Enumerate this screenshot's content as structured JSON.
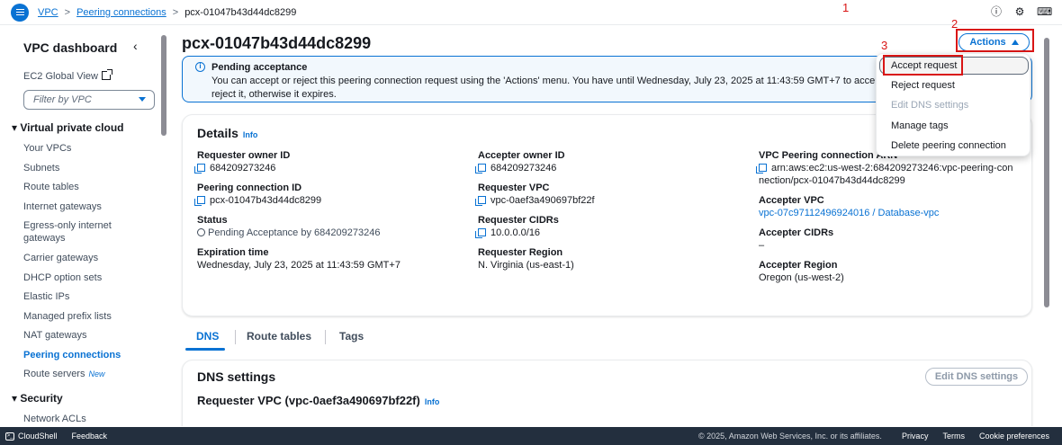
{
  "breadcrumb": {
    "root": "VPC",
    "parent": "Peering connections",
    "current": "pcx-01047b43d44dc8299"
  },
  "annotations": {
    "one": "1",
    "two": "2",
    "three": "3"
  },
  "top_icons": [
    "info-circle-icon",
    "settings-icon",
    "feedback-icon"
  ],
  "sidebar": {
    "title": "VPC dashboard",
    "ec2_global_view": "EC2 Global View",
    "filter_placeholder": "Filter by VPC",
    "section_vpc": "Virtual private cloud",
    "items": [
      "Your VPCs",
      "Subnets",
      "Route tables",
      "Internet gateways",
      "Egress-only internet gateways",
      "Carrier gateways",
      "DHCP option sets",
      "Elastic IPs",
      "Managed prefix lists",
      "NAT gateways",
      "Peering connections",
      "Route servers"
    ],
    "new_badge": "New",
    "section_security": "Security",
    "security_items": [
      "Network ACLs"
    ]
  },
  "page": {
    "title": "pcx-01047b43d44dc8299",
    "actions_label": "Actions"
  },
  "alert": {
    "title": "Pending acceptance",
    "body": "You can accept or reject this peering connection request using the 'Actions' menu. You have until Wednesday, July 23, 2025 at 11:43:59 GMT+7 to accept or reject it, otherwise it expires."
  },
  "details": {
    "title": "Details",
    "info": "Info",
    "requester_owner_id_label": "Requester owner ID",
    "requester_owner_id": "684209273246",
    "peering_id_label": "Peering connection ID",
    "peering_id": "pcx-01047b43d44dc8299",
    "status_label": "Status",
    "status": "Pending Acceptance by 684209273246",
    "expiration_label": "Expiration time",
    "expiration": "Wednesday, July 23, 2025 at 11:43:59 GMT+7",
    "accepter_owner_id_label": "Accepter owner ID",
    "accepter_owner_id": "684209273246",
    "requester_vpc_label": "Requester VPC",
    "requester_vpc": "vpc-0aef3a490697bf22f",
    "requester_cidrs_label": "Requester CIDRs",
    "requester_cidrs": "10.0.0.0/16",
    "requester_region_label": "Requester Region",
    "requester_region": "N. Virginia (us-east-1)",
    "arn_label": "VPC Peering connection ARN",
    "arn_line1": "arn:aws:ec2:us-west-2:684209273246:vpc-peering-con",
    "arn_line2": "nection/pcx-01047b43d44dc8299",
    "accepter_vpc_label": "Accepter VPC",
    "accepter_vpc": "vpc-07c97112496924016 / Database-vpc",
    "accepter_cidrs_label": "Accepter CIDRs",
    "accepter_cidrs": "–",
    "accepter_region_label": "Accepter Region",
    "accepter_region": "Oregon (us-west-2)"
  },
  "tabs": [
    "DNS",
    "Route tables",
    "Tags"
  ],
  "dns": {
    "title": "DNS settings",
    "edit_label": "Edit DNS settings",
    "subtitle": "Requester VPC (vpc-0aef3a490697bf22f)",
    "info": "Info"
  },
  "dropdown": [
    "Accept request",
    "Reject request",
    "Edit DNS settings",
    "Manage tags",
    "Delete peering connection"
  ],
  "footer": {
    "cloudshell": "CloudShell",
    "feedback": "Feedback",
    "copyright": "© 2025, Amazon Web Services, Inc. or its affiliates.",
    "privacy": "Privacy",
    "terms": "Terms",
    "cookies": "Cookie preferences"
  }
}
